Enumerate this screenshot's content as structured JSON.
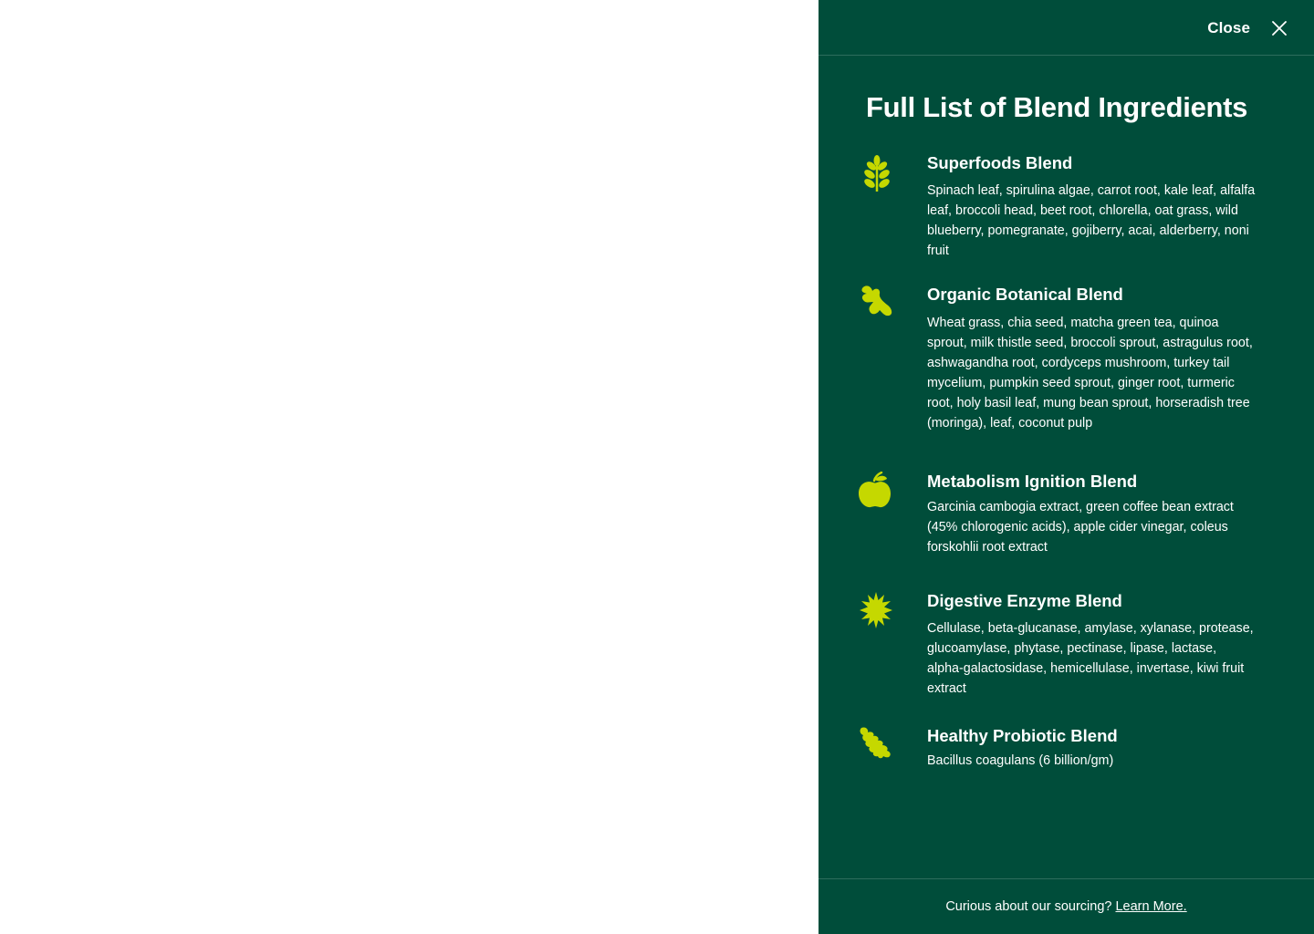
{
  "header": {
    "close_label": "Close"
  },
  "title": "Full List of Blend Ingredients",
  "colors": {
    "panel": "#004d3a",
    "accent": "#c5d800",
    "text": "#ffffff"
  },
  "blends": [
    {
      "icon": "leaf-sprig-icon",
      "name": "Superfoods Blend",
      "description": "Spinach leaf, spirulina algae, carrot root, kale leaf, alfalfa leaf, broccoli head, beet root, chlorella, oat grass, wild blueberry, pomegranate, gojiberry, acai, alderberry, noni fruit"
    },
    {
      "icon": "ginger-root-icon",
      "name": "Organic Botanical Blend",
      "description": "Wheat grass, chia seed, matcha green tea, quinoa sprout, milk thistle seed, broccoli sprout, astragulus root, ashwagandha root, cordyceps mushroom, turkey tail mycelium, pumpkin seed sprout, ginger root, turmeric root, holy basil leaf, mung bean sprout, horseradish tree (moringa), leaf, coconut pulp"
    },
    {
      "icon": "apple-icon",
      "name": "Metabolism Ignition Blend",
      "description": "Garcinia cambogia extract, green coffee bean extract (45% chlorogenic acids), apple cider vinegar, coleus forskohlii root extract"
    },
    {
      "icon": "starburst-icon",
      "name": "Digestive Enzyme Blend",
      "description": "Cellulase, beta-glucanase, amylase, xylanase, protease, glucoamylase, phytase, pectinase, lipase, lactase, alpha-galactosidase, hemicellulase, invertase, kiwi fruit extract"
    },
    {
      "icon": "oak-leaf-icon",
      "name": "Healthy Probiotic Blend",
      "description": "Bacillus coagulans (6 billion/gm)"
    }
  ],
  "footer": {
    "text": "Curious about our sourcing?",
    "link": "Learn More."
  }
}
